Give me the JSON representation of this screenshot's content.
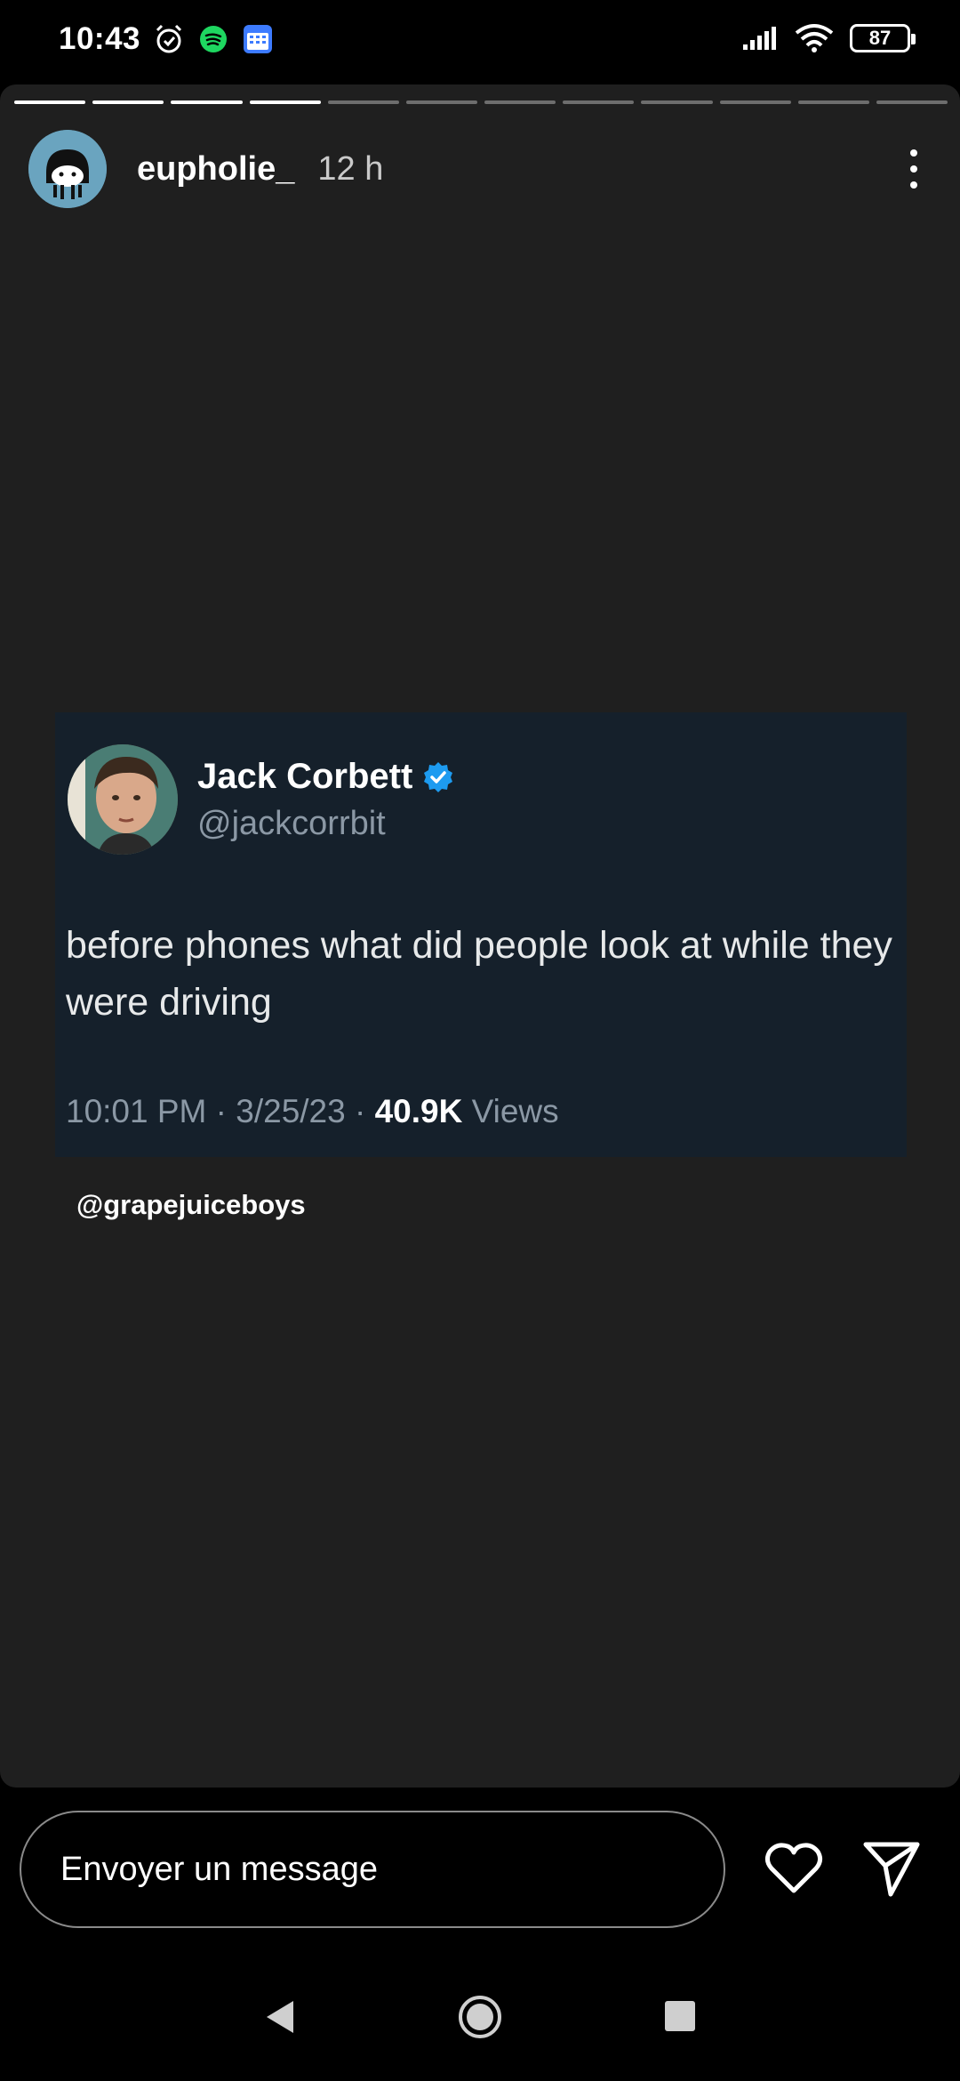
{
  "status_bar": {
    "time": "10:43",
    "battery": "87",
    "left_icons": [
      "alarm-icon",
      "spotify-icon",
      "calendar-icon"
    ],
    "right_icons": [
      "signal-icon",
      "wifi-icon",
      "battery-icon"
    ]
  },
  "story": {
    "progress_total": 12,
    "progress_done": 4,
    "username": "eupholie_",
    "time_ago": "12 h"
  },
  "tweet": {
    "name": "Jack Corbett",
    "handle": "@jackcorrbit",
    "text": "before phones what did people look at while they were driving",
    "time": "10:01 PM",
    "date": "3/25/23",
    "views_count": "40.9K",
    "views_label": "Views"
  },
  "credit": "@grapejuiceboys",
  "message_bar": {
    "placeholder": "Envoyer un message"
  },
  "colors": {
    "story_bg": "#1f1f1f",
    "tweet_bg": "#15202b",
    "verified": "#1d9bf0"
  }
}
